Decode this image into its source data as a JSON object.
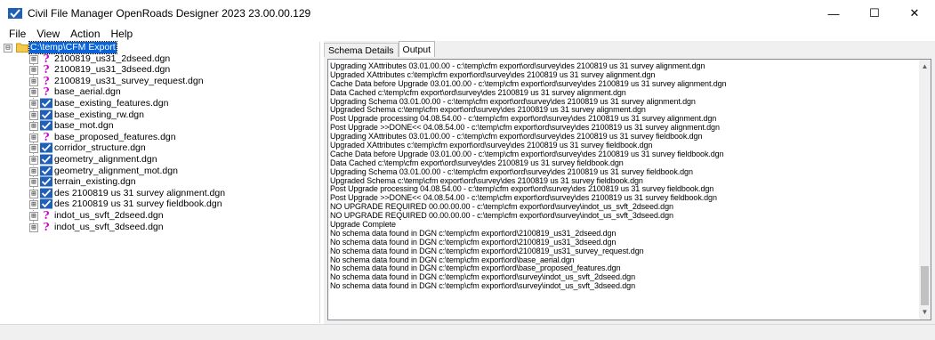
{
  "window": {
    "title": "Civil File Manager OpenRoads Designer 2023 23.00.00.129",
    "minimize_glyph": "—",
    "maximize_glyph": "☐",
    "close_glyph": "✕"
  },
  "menu": [
    "File",
    "View",
    "Action",
    "Help"
  ],
  "tree": {
    "root": {
      "label": "C:\\temp\\CFM Export",
      "expander": "⊟",
      "icon": "folder-icon"
    },
    "items": [
      {
        "label": "2100819_us31_2dseed.dgn",
        "icon": "question-icon"
      },
      {
        "label": "2100819_us31_3dseed.dgn",
        "icon": "question-icon"
      },
      {
        "label": "2100819_us31_survey_request.dgn",
        "icon": "question-icon"
      },
      {
        "label": "base_aerial.dgn",
        "icon": "question-icon"
      },
      {
        "label": "base_existing_features.dgn",
        "icon": "check-icon"
      },
      {
        "label": "base_existing_rw.dgn",
        "icon": "check-icon"
      },
      {
        "label": "base_mot.dgn",
        "icon": "check-icon"
      },
      {
        "label": "base_proposed_features.dgn",
        "icon": "question-icon"
      },
      {
        "label": "corridor_structure.dgn",
        "icon": "check-icon"
      },
      {
        "label": "geometry_alignment.dgn",
        "icon": "check-icon"
      },
      {
        "label": "geometry_alignment_mot.dgn",
        "icon": "check-icon"
      },
      {
        "label": "terrain_existing.dgn",
        "icon": "check-icon"
      },
      {
        "label": "des 2100819 us 31 survey alignment.dgn",
        "icon": "check-icon"
      },
      {
        "label": "des 2100819 us 31 survey fieldbook.dgn",
        "icon": "check-icon"
      },
      {
        "label": "indot_us_svft_2dseed.dgn",
        "icon": "question-icon"
      },
      {
        "label": "indot_us_svft_3dseed.dgn",
        "icon": "question-icon"
      }
    ],
    "child_expander": "⊞"
  },
  "tabs": [
    {
      "label": "Schema Details",
      "active": false
    },
    {
      "label": "Output",
      "active": true
    }
  ],
  "output_lines": [
    "Upgrading XAttributes 03.01.00.00 - c:\\temp\\cfm export\\ord\\survey\\des 2100819 us 31 survey alignment.dgn",
    "Upgraded XAttributes c:\\temp\\cfm export\\ord\\survey\\des 2100819 us 31 survey alignment.dgn",
    "Cache Data before Upgrade 03.01.00.00 - c:\\temp\\cfm export\\ord\\survey\\des 2100819 us 31 survey alignment.dgn",
    "Data Cached c:\\temp\\cfm export\\ord\\survey\\des 2100819 us 31 survey alignment.dgn",
    "Upgrading Schema 03.01.00.00 - c:\\temp\\cfm export\\ord\\survey\\des 2100819 us 31 survey alignment.dgn",
    "Upgraded Schema c:\\temp\\cfm export\\ord\\survey\\des 2100819 us 31 survey alignment.dgn",
    "Post Upgrade processing 04.08.54.00 - c:\\temp\\cfm export\\ord\\survey\\des 2100819 us 31 survey alignment.dgn",
    "Post Upgrade >>DONE<< 04.08.54.00 - c:\\temp\\cfm export\\ord\\survey\\des 2100819 us 31 survey alignment.dgn",
    "Upgrading XAttributes 03.01.00.00 - c:\\temp\\cfm export\\ord\\survey\\des 2100819 us 31 survey fieldbook.dgn",
    "Upgraded XAttributes c:\\temp\\cfm export\\ord\\survey\\des 2100819 us 31 survey fieldbook.dgn",
    "Cache Data before Upgrade 03.01.00.00 - c:\\temp\\cfm export\\ord\\survey\\des 2100819 us 31 survey fieldbook.dgn",
    "Data Cached c:\\temp\\cfm export\\ord\\survey\\des 2100819 us 31 survey fieldbook.dgn",
    "Upgrading Schema 03.01.00.00 - c:\\temp\\cfm export\\ord\\survey\\des 2100819 us 31 survey fieldbook.dgn",
    "Upgraded Schema c:\\temp\\cfm export\\ord\\survey\\des 2100819 us 31 survey fieldbook.dgn",
    "Post Upgrade processing 04.08.54.00 - c:\\temp\\cfm export\\ord\\survey\\des 2100819 us 31 survey fieldbook.dgn",
    "Post Upgrade >>DONE<< 04.08.54.00 - c:\\temp\\cfm export\\ord\\survey\\des 2100819 us 31 survey fieldbook.dgn",
    "NO UPGRADE REQUIRED 00.00.00.00 - c:\\temp\\cfm export\\ord\\survey\\indot_us_svft_2dseed.dgn",
    "NO UPGRADE REQUIRED 00.00.00.00 - c:\\temp\\cfm export\\ord\\survey\\indot_us_svft_3dseed.dgn",
    "Upgrade Complete",
    "No schema data found in DGN c:\\temp\\cfm export\\ord\\2100819_us31_2dseed.dgn",
    "No schema data found in DGN c:\\temp\\cfm export\\ord\\2100819_us31_3dseed.dgn",
    "No schema data found in DGN c:\\temp\\cfm export\\ord\\2100819_us31_survey_request.dgn",
    "No schema data found in DGN c:\\temp\\cfm export\\ord\\base_aerial.dgn",
    "No schema data found in DGN c:\\temp\\cfm export\\ord\\base_proposed_features.dgn",
    "No schema data found in DGN c:\\temp\\cfm export\\ord\\survey\\indot_us_svft_2dseed.dgn",
    "No schema data found in DGN c:\\temp\\cfm export\\ord\\survey\\indot_us_svft_3dseed.dgn"
  ],
  "scroll": {
    "up_glyph": "▲",
    "down_glyph": "▼"
  },
  "colors": {
    "selection": "#0a64d8",
    "question_icon": "#d400d4",
    "check_icon_bg": "#1f5fb8"
  }
}
